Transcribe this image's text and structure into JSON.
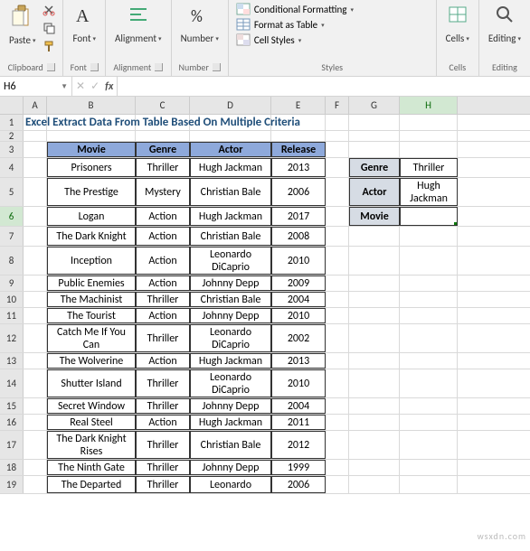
{
  "ribbon": {
    "clipboard": {
      "label": "Clipboard",
      "paste": "Paste"
    },
    "font": {
      "label": "Font",
      "btn": "Font"
    },
    "alignment": {
      "label": "Alignment",
      "btn": "Alignment"
    },
    "number": {
      "label": "Number",
      "btn": "Number"
    },
    "styles": {
      "label": "Styles",
      "cond": "Conditional Formatting",
      "table": "Format as Table",
      "cell": "Cell Styles"
    },
    "cells": {
      "label": "Cells",
      "btn": "Cells"
    },
    "editing": {
      "label": "Editing",
      "btn": "Editing"
    }
  },
  "namebox": "H6",
  "formula": "",
  "title": "Excel Extract Data From Table Based On Multiple Criteria",
  "columns": [
    "A",
    "B",
    "C",
    "D",
    "E",
    "F",
    "G",
    "H"
  ],
  "headers": {
    "movie": "Movie",
    "genre": "Genre",
    "actor": "Actor",
    "release": "Release"
  },
  "data": [
    {
      "movie": "Prisoners",
      "genre": "Thriller",
      "actor": "Hugh Jackman",
      "release": "2013"
    },
    {
      "movie": "The Prestige",
      "genre": "Mystery",
      "actor": "Christian Bale",
      "release": "2006"
    },
    {
      "movie": "Logan",
      "genre": "Action",
      "actor": "Hugh Jackman",
      "release": "2017"
    },
    {
      "movie": "The Dark Knight",
      "genre": "Action",
      "actor": "Christian Bale",
      "release": "2008"
    },
    {
      "movie": "Inception",
      "genre": "Action",
      "actor": "Leonardo DiCaprio",
      "release": "2010"
    },
    {
      "movie": "Public Enemies",
      "genre": "Action",
      "actor": "Johnny Depp",
      "release": "2009"
    },
    {
      "movie": "The Machinist",
      "genre": "Thriller",
      "actor": "Christian Bale",
      "release": "2004"
    },
    {
      "movie": "The Tourist",
      "genre": "Action",
      "actor": "Johnny Depp",
      "release": "2010"
    },
    {
      "movie": "Catch Me If You Can",
      "genre": "Thriller",
      "actor": "Leonardo DiCaprio",
      "release": "2002"
    },
    {
      "movie": "The Wolverine",
      "genre": "Action",
      "actor": "Hugh Jackman",
      "release": "2013"
    },
    {
      "movie": "Shutter Island",
      "genre": "Thriller",
      "actor": "Leonardo DiCaprio",
      "release": "2010"
    },
    {
      "movie": "Secret Window",
      "genre": "Thriller",
      "actor": "Johnny Depp",
      "release": "2004"
    },
    {
      "movie": "Real Steel",
      "genre": "Action",
      "actor": "Hugh Jackman",
      "release": "2011"
    },
    {
      "movie": "The Dark Knight Rises",
      "genre": "Thriller",
      "actor": "Christian Bale",
      "release": "2012"
    },
    {
      "movie": "The Ninth Gate",
      "genre": "Thriller",
      "actor": "Johnny Depp",
      "release": "1999"
    },
    {
      "movie": "The Departed",
      "genre": "Thriller",
      "actor": "Leonardo",
      "release": "2006"
    }
  ],
  "criteria": {
    "genreLabel": "Genre",
    "genreVal": "Thriller",
    "actorLabel": "Actor",
    "actorVal": "Hugh Jackman",
    "movieLabel": "Movie",
    "movieVal": ""
  },
  "rowHeights": {
    "r1": 18,
    "r2": 12,
    "r3": 18,
    "r4": 22,
    "r5": 32,
    "r6": 22,
    "r7": 22,
    "r8": 32,
    "r9": 18,
    "r10": 18,
    "r11": 18,
    "r12": 32,
    "r13": 18,
    "r14": 32,
    "r15": 18,
    "r16": 18,
    "r17": 32,
    "r18": 18,
    "r19": 20
  },
  "watermark": "wsxdn.com"
}
